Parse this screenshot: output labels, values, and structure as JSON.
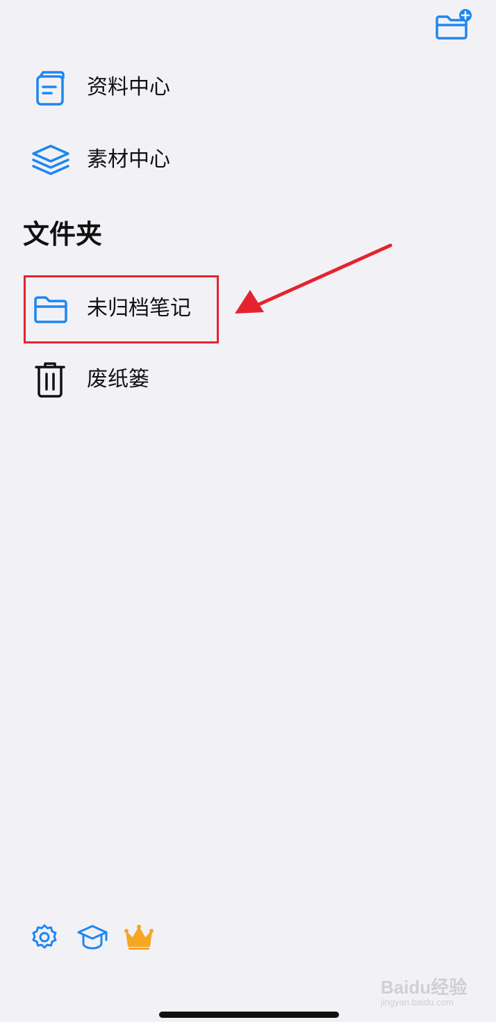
{
  "header": {
    "new_folder_icon": "folder-plus-icon"
  },
  "nav": {
    "items": [
      {
        "label": "资料中心",
        "icon": "book-icon"
      },
      {
        "label": "素材中心",
        "icon": "layers-icon"
      }
    ]
  },
  "folders": {
    "title": "文件夹",
    "items": [
      {
        "label": "未归档笔记",
        "icon": "folder-icon",
        "highlighted": true
      },
      {
        "label": "废纸篓",
        "icon": "trash-icon"
      }
    ]
  },
  "footer": {
    "icons": [
      "gear-icon",
      "graduation-cap-icon",
      "crown-icon"
    ]
  },
  "watermark": {
    "brand": "Baidu经验",
    "url": "jingyan.baidu.com"
  },
  "colors": {
    "accent": "#1e86f0",
    "highlight": "#e5232e",
    "crown": "#f6a623",
    "background": "#f2f1f6"
  }
}
